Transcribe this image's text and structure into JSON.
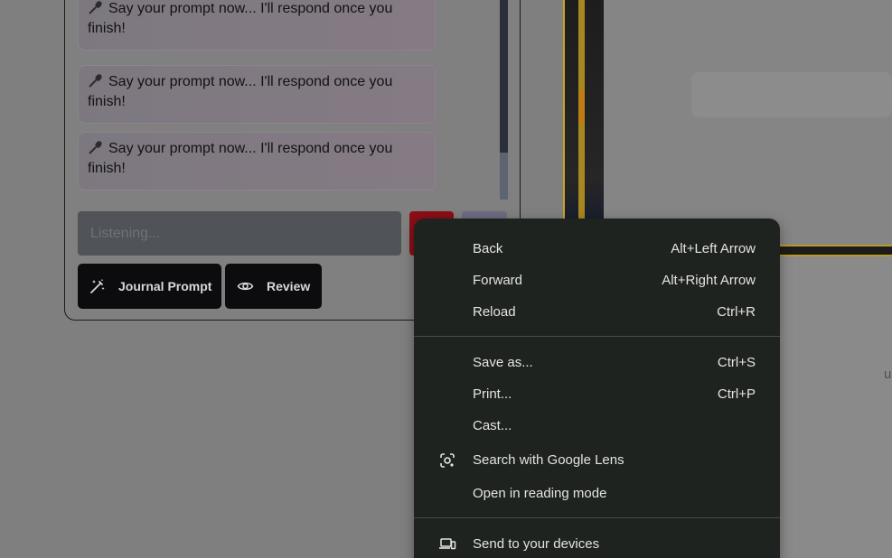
{
  "chat": {
    "messages": [
      {
        "icon": "microphone-icon",
        "text": "Say your prompt now... I'll respond once you finish!"
      },
      {
        "icon": "microphone-icon",
        "text": "Say your prompt now... I'll respond once you finish!"
      },
      {
        "icon": "microphone-icon",
        "text": "Say your prompt now... I'll respond once you finish!"
      }
    ],
    "input_placeholder": "Listening...",
    "journal_prompt_label": "Journal Prompt",
    "review_label": "Review"
  },
  "context_menu": {
    "group1": [
      {
        "label": "Back",
        "shortcut": "Alt+Left Arrow"
      },
      {
        "label": "Forward",
        "shortcut": "Alt+Right Arrow"
      },
      {
        "label": "Reload",
        "shortcut": "Ctrl+R"
      }
    ],
    "group2": [
      {
        "label": "Save as...",
        "shortcut": "Ctrl+S"
      },
      {
        "label": "Print...",
        "shortcut": "Ctrl+P"
      },
      {
        "label": "Cast..."
      },
      {
        "label": "Search with Google Lens",
        "icon": "google-lens-icon"
      },
      {
        "label": "Open in reading mode"
      }
    ],
    "group3": [
      {
        "label": "Send to your devices",
        "icon": "devices-icon"
      }
    ]
  },
  "background": {
    "edge_text": "u"
  },
  "colors": {
    "overlay": "#7f7f7f",
    "menu_bg": "#1f2320",
    "menu_text": "#e3e3e3",
    "button_dark": "#0c0c0e",
    "stop_red": "#8a0e16"
  }
}
